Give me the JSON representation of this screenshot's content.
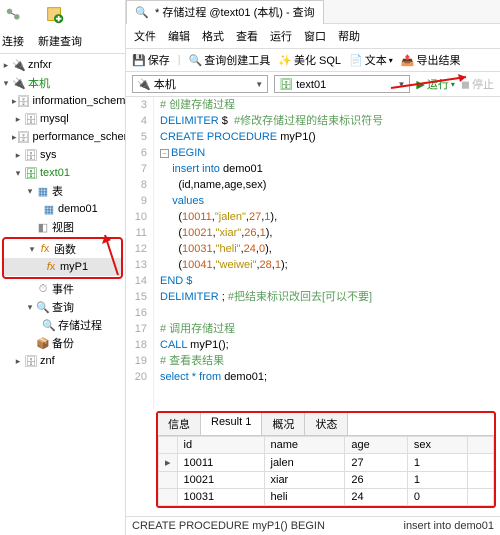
{
  "sidebar": {
    "toolbar": {
      "connect": "连接",
      "newquery": "新建查询"
    },
    "tree": {
      "znfxr": "znfxr",
      "local": "本机",
      "info": "information_schema",
      "mysql": "mysql",
      "perf": "performance_schema",
      "sys": "sys",
      "text01": "text01",
      "tables": "表",
      "demo01": "demo01",
      "views": "视图",
      "functions": "函数",
      "myp1": "myP1",
      "events": "事件",
      "queries": "查询",
      "sp": "存储过程",
      "backup": "备份",
      "znf": "znf"
    }
  },
  "tabTitle": "* 存储过程 @text01 (本机) - 查询",
  "menu": {
    "file": "文件",
    "edit": "编辑",
    "format": "格式",
    "view": "查看",
    "run": "运行",
    "window": "窗口",
    "help": "帮助"
  },
  "toolbar": {
    "save": "保存",
    "builder": "查询创建工具",
    "beautify": "美化 SQL",
    "text": "文本",
    "export": "导出结果"
  },
  "combo1": "本机",
  "combo2": "text01",
  "run": "运行",
  "stop": "停止",
  "code": {
    "l3": "# 创建存储过程",
    "l4a": "DELIMITER",
    "l4b": " $  ",
    "l4c": "#修改存储过程的结束标识符号",
    "l5a": "CREATE PROCEDURE ",
    "l5b": "myP1()",
    "l6": "BEGIN",
    "l7a": "    insert into ",
    "l7b": "demo01",
    "l8": "      (id,name,age,sex)",
    "l9": "    values",
    "l10a": "      (",
    "l10b": "10011",
    "l10c": ",",
    "l10d": "\"jalen\"",
    "l10e": ",",
    "l10f": "27",
    "l10g": ",",
    "l10h": "1",
    "l10i": "),",
    "l11a": "      (",
    "l11b": "10021",
    "l11c": ",",
    "l11d": "\"xiar\"",
    "l11e": ",",
    "l11f": "26",
    "l11g": ",",
    "l11h": "1",
    "l11i": "),",
    "l12a": "      (",
    "l12b": "10031",
    "l12c": ",",
    "l12d": "\"heli\"",
    "l12e": ",",
    "l12f": "24",
    "l12g": ",",
    "l12h": "0",
    "l12i": "),",
    "l13a": "      (",
    "l13b": "10041",
    "l13c": ",",
    "l13d": "\"weiwei\"",
    "l13e": ",",
    "l13f": "28",
    "l13g": ",",
    "l13h": "1",
    "l13i": ");",
    "l14": "END $",
    "l15a": "DELIMITER ",
    "l15b": "; ",
    "l15c": "#把结束标识改回去[可以不要]",
    "l17": "# 调用存储过程",
    "l18a": "CALL ",
    "l18b": "myP1();",
    "l19": "# 查看表结果",
    "l20a": "select * from ",
    "l20b": "demo01;"
  },
  "result": {
    "tabs": {
      "info": "信息",
      "r1": "Result 1",
      "prof": "概况",
      "status": "状态"
    },
    "cols": {
      "id": "id",
      "name": "name",
      "age": "age",
      "sex": "sex"
    },
    "rows": [
      {
        "id": "10011",
        "name": "jalen",
        "age": "27",
        "sex": "1"
      },
      {
        "id": "10021",
        "name": "xiar",
        "age": "26",
        "sex": "1"
      },
      {
        "id": "10031",
        "name": "heli",
        "age": "24",
        "sex": "0"
      }
    ]
  },
  "status": {
    "left": "CREATE PROCEDURE myP1() BEGIN",
    "right": "insert into demo01"
  }
}
